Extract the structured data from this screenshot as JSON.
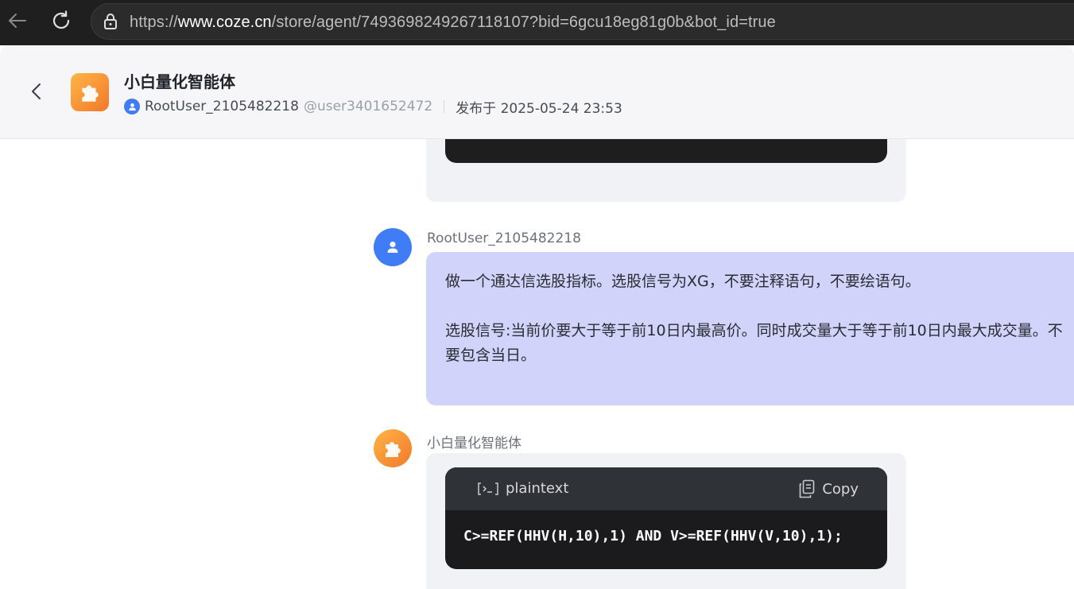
{
  "browser": {
    "url_prefix": "https://",
    "url_host": "www.coze.cn",
    "url_path": "/store/agent/7493698249267118107?bid=6gcu18eg81g0b&bot_id=true"
  },
  "header": {
    "title": "小白量化智能体",
    "author_name": "RootUser_2105482218",
    "author_handle": "@user3401652472",
    "published": "发布于 2025-05-24 23:53"
  },
  "messages": {
    "user": {
      "sender": "RootUser_2105482218",
      "line1": "做一个通达信选股指标。选股信号为XG，不要注释语句，不要绘语句。",
      "line2": "选股信号:当前价要大于等于前10日内最高价。同时成交量大于等于前10日内最大成交量。不要包含当日。"
    },
    "bot": {
      "sender": "小白量化智能体",
      "code_lang": "plaintext",
      "copy_label": "Copy",
      "code": "C>=REF(HHV(H,10),1) AND V>=REF(HHV(V,10),1);"
    }
  },
  "colors": {
    "user_bubble": "#d2d3fb",
    "bot_bubble": "#f1f2f6",
    "code_bg": "#1b1b1d",
    "accent_blue": "#3f7cf6",
    "avatar_orange": "#f2782a"
  }
}
